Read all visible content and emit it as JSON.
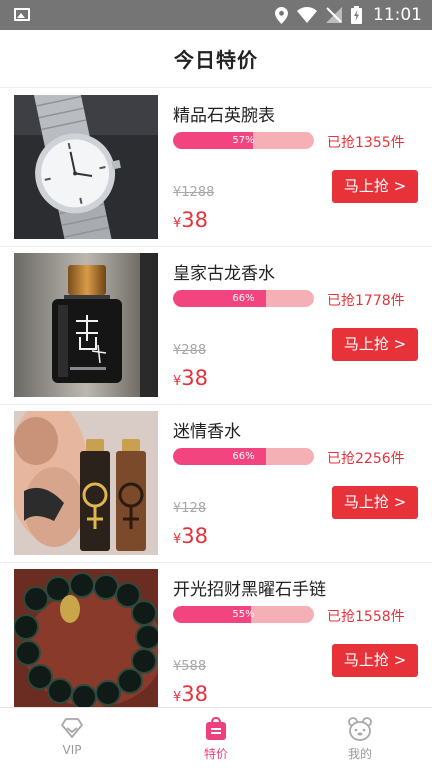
{
  "status_bar": {
    "time": "11:01"
  },
  "header": {
    "title": "今日特价"
  },
  "products": [
    {
      "name": "精品石英腕表",
      "progress_label": "57%",
      "progress": 57,
      "sold": "已抢1355件",
      "old_price": "¥1288",
      "currency": "¥",
      "price": "38",
      "button": "马上抢 >",
      "image_icon": "watch-image"
    },
    {
      "name": "皇家古龙香水",
      "progress_label": "66%",
      "progress": 66,
      "sold": "已抢1778件",
      "old_price": "¥288",
      "currency": "¥",
      "price": "38",
      "button": "马上抢 >",
      "image_icon": "perfume-image"
    },
    {
      "name": "迷情香水",
      "progress_label": "66%",
      "progress": 66,
      "sold": "已抢2256件",
      "old_price": "¥128",
      "currency": "¥",
      "price": "38",
      "button": "马上抢 >",
      "image_icon": "couple-perfume-image"
    },
    {
      "name": "开光招财黑曜石手链",
      "progress_label": "55%",
      "progress": 55,
      "sold": "已抢1558件",
      "old_price": "¥588",
      "currency": "¥",
      "price": "38",
      "button": "马上抢 >",
      "image_icon": "bracelet-image"
    }
  ],
  "tabs": [
    {
      "label": "VIP",
      "icon": "diamond-icon",
      "active": false
    },
    {
      "label": "特价",
      "icon": "shopping-bag-icon",
      "active": true
    },
    {
      "label": "我的",
      "icon": "bear-face-icon",
      "active": false
    }
  ],
  "colors": {
    "accent_red": "#e8323a",
    "progress_pink": "#f2457f",
    "progress_track": "#f5b0b5",
    "active_tab": "#ef3f7c",
    "status_bar": "#757575"
  }
}
